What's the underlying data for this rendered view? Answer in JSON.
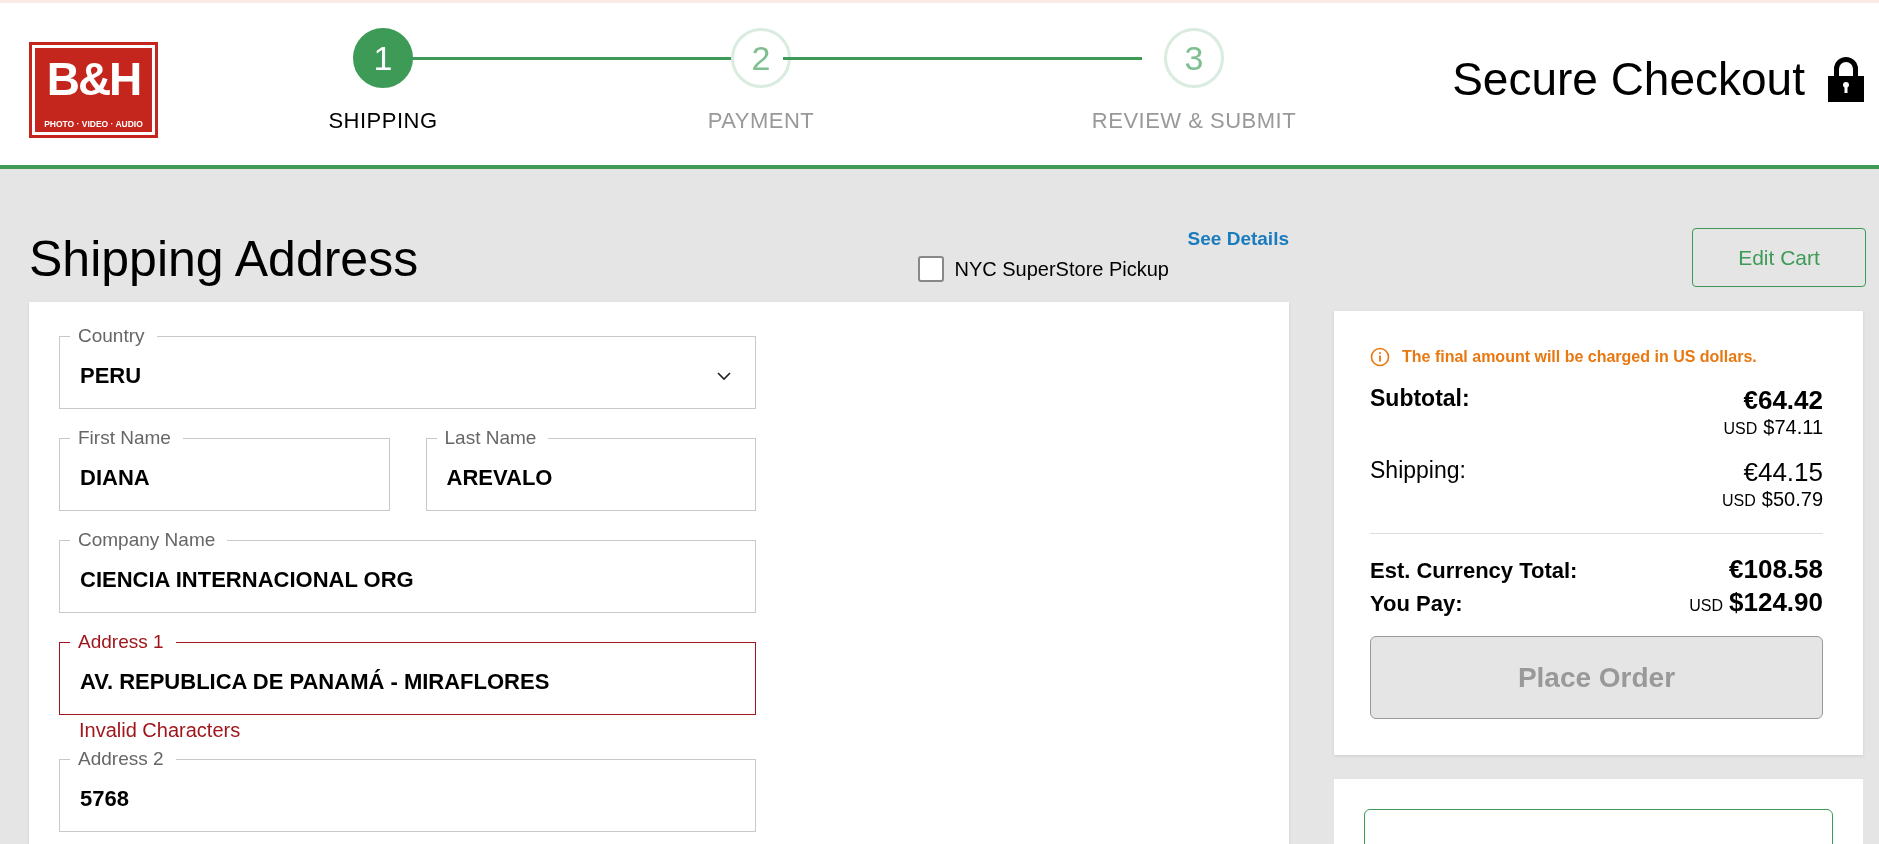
{
  "logo": {
    "mark": "B&H",
    "tagline": "PHOTO · VIDEO · AUDIO"
  },
  "steps": [
    {
      "number": "1",
      "label": "SHIPPING",
      "selected": true
    },
    {
      "number": "2",
      "label": "PAYMENT",
      "selected": false
    },
    {
      "number": "3",
      "label": "REVIEW & SUBMIT",
      "selected": false
    }
  ],
  "secure_checkout": "Secure Checkout",
  "shipping": {
    "title": "Shipping Address",
    "see_details": "See Details",
    "pickup": {
      "label": "NYC SuperStore Pickup",
      "checked": false
    },
    "fields": [
      [
        {
          "kind": "select",
          "label": "Country",
          "value": "PERU",
          "error": false
        }
      ],
      [
        {
          "kind": "text",
          "label": "First Name",
          "value": "DIANA",
          "error": false
        },
        {
          "kind": "text",
          "label": "Last Name",
          "value": "AREVALO",
          "error": false
        }
      ],
      [
        {
          "kind": "text",
          "label": "Company Name",
          "value": "CIENCIA INTERNACIONAL ORG",
          "error": false
        }
      ],
      [
        {
          "kind": "text",
          "label": "Address 1",
          "value": "AV. REPUBLICA DE PANAMÁ - MIRAFLORES",
          "error": true,
          "error_message": "Invalid Characters"
        }
      ],
      [
        {
          "kind": "text",
          "label": "Address 2",
          "value": "5768",
          "error": false
        }
      ]
    ]
  },
  "summary": {
    "edit_cart": "Edit Cart",
    "notice": "The final amount will be charged in US dollars.",
    "lines": [
      {
        "kind": "bold",
        "label": "Subtotal:",
        "amount": "€64.42",
        "currency": "USD",
        "usd": "$74.11"
      },
      {
        "kind": "plain",
        "label": "Shipping:",
        "amount": "€44.15",
        "currency": "USD",
        "usd": "$50.79"
      }
    ],
    "total": {
      "label": "Est. Currency Total:",
      "amount": "€108.58"
    },
    "pay": {
      "label": "You Pay:",
      "currency": "USD",
      "amount": "$124.90"
    },
    "place_order": {
      "label": "Place Order",
      "disabled": true
    }
  }
}
